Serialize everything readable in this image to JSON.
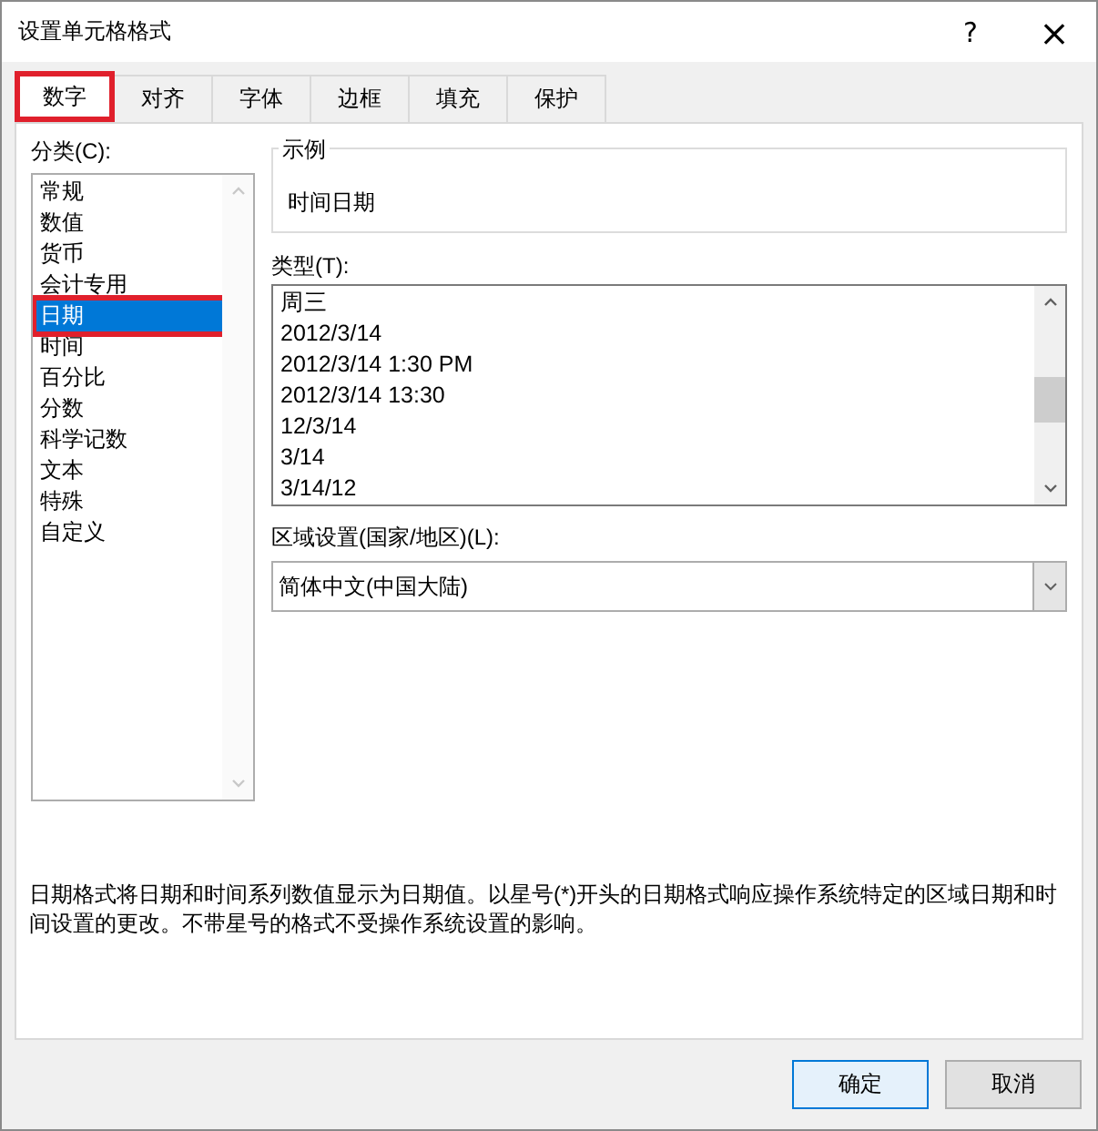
{
  "window": {
    "title": "设置单元格格式",
    "help": "?",
    "close": "×"
  },
  "tabs": [
    {
      "label": "数字",
      "selected": true,
      "highlighted": true
    },
    {
      "label": "对齐",
      "selected": false,
      "highlighted": false
    },
    {
      "label": "字体",
      "selected": false,
      "highlighted": false
    },
    {
      "label": "边框",
      "selected": false,
      "highlighted": false
    },
    {
      "label": "填充",
      "selected": false,
      "highlighted": false
    },
    {
      "label": "保护",
      "selected": false,
      "highlighted": false
    }
  ],
  "category": {
    "label": "分类(C):",
    "items": [
      {
        "label": "常规",
        "selected": false,
        "highlighted": false
      },
      {
        "label": "数值",
        "selected": false,
        "highlighted": false
      },
      {
        "label": "货币",
        "selected": false,
        "highlighted": false
      },
      {
        "label": "会计专用",
        "selected": false,
        "highlighted": false
      },
      {
        "label": "日期",
        "selected": true,
        "highlighted": true
      },
      {
        "label": "时间",
        "selected": false,
        "highlighted": false
      },
      {
        "label": "百分比",
        "selected": false,
        "highlighted": false
      },
      {
        "label": "分数",
        "selected": false,
        "highlighted": false
      },
      {
        "label": "科学记数",
        "selected": false,
        "highlighted": false
      },
      {
        "label": "文本",
        "selected": false,
        "highlighted": false
      },
      {
        "label": "特殊",
        "selected": false,
        "highlighted": false
      },
      {
        "label": "自定义",
        "selected": false,
        "highlighted": false
      }
    ]
  },
  "sample": {
    "label": "示例",
    "value": "时间日期"
  },
  "type": {
    "label": "类型(T):",
    "items": [
      "周三",
      "2012/3/14",
      "2012/3/14 1:30 PM",
      "2012/3/14 13:30",
      "12/3/14",
      "3/14",
      "3/14/12"
    ]
  },
  "locale": {
    "label": "区域设置(国家/地区)(L):",
    "value": "简体中文(中国大陆)"
  },
  "description": "日期格式将日期和时间系列数值显示为日期值。以星号(*)开头的日期格式响应操作系统特定的区域日期和时间设置的更改。不带星号的格式不受操作系统设置的影响。",
  "buttons": [
    {
      "label": "确定",
      "kind": "default"
    },
    {
      "label": "取消",
      "kind": "normal"
    }
  ]
}
